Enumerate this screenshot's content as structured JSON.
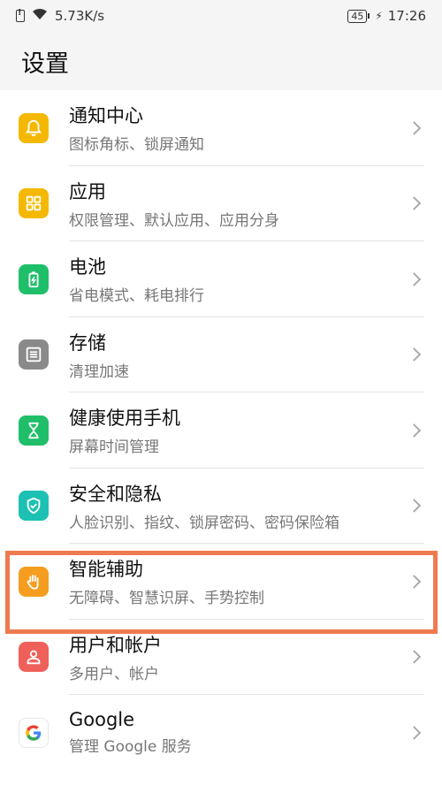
{
  "status_bar": {
    "network_speed": "5.73K/s",
    "battery_level": "45",
    "time": "17:26"
  },
  "header": {
    "title": "设置"
  },
  "settings_items": [
    {
      "title": "通知中心",
      "subtitle": "图标角标、锁屏通知",
      "icon": "bell-icon",
      "color": "#f5b800"
    },
    {
      "title": "应用",
      "subtitle": "权限管理、默认应用、应用分身",
      "icon": "apps-grid-icon",
      "color": "#f5b800"
    },
    {
      "title": "电池",
      "subtitle": "省电模式、耗电排行",
      "icon": "battery-icon",
      "color": "#1fbf6a"
    },
    {
      "title": "存储",
      "subtitle": "清理加速",
      "icon": "storage-icon",
      "color": "#8a8a8a"
    },
    {
      "title": "健康使用手机",
      "subtitle": "屏幕时间管理",
      "icon": "hourglass-icon",
      "color": "#1fbf6a"
    },
    {
      "title": "安全和隐私",
      "subtitle": "人脸识别、指纹、锁屏密码、密码保险箱",
      "icon": "shield-icon",
      "color": "#1cc1b3"
    },
    {
      "title": "智能辅助",
      "subtitle": "无障碍、智慧识屏、手势控制",
      "icon": "hand-icon",
      "color": "#f59d1e"
    },
    {
      "title": "用户和帐户",
      "subtitle": "多用户、帐户",
      "icon": "user-icon",
      "color": "#f0605a"
    },
    {
      "title": "Google",
      "subtitle": "管理 Google 服务",
      "icon": "google-icon",
      "color": "#ffffff"
    }
  ],
  "colors": {
    "highlight": "#ef7a4f",
    "background_header": "#f5f5f5"
  }
}
